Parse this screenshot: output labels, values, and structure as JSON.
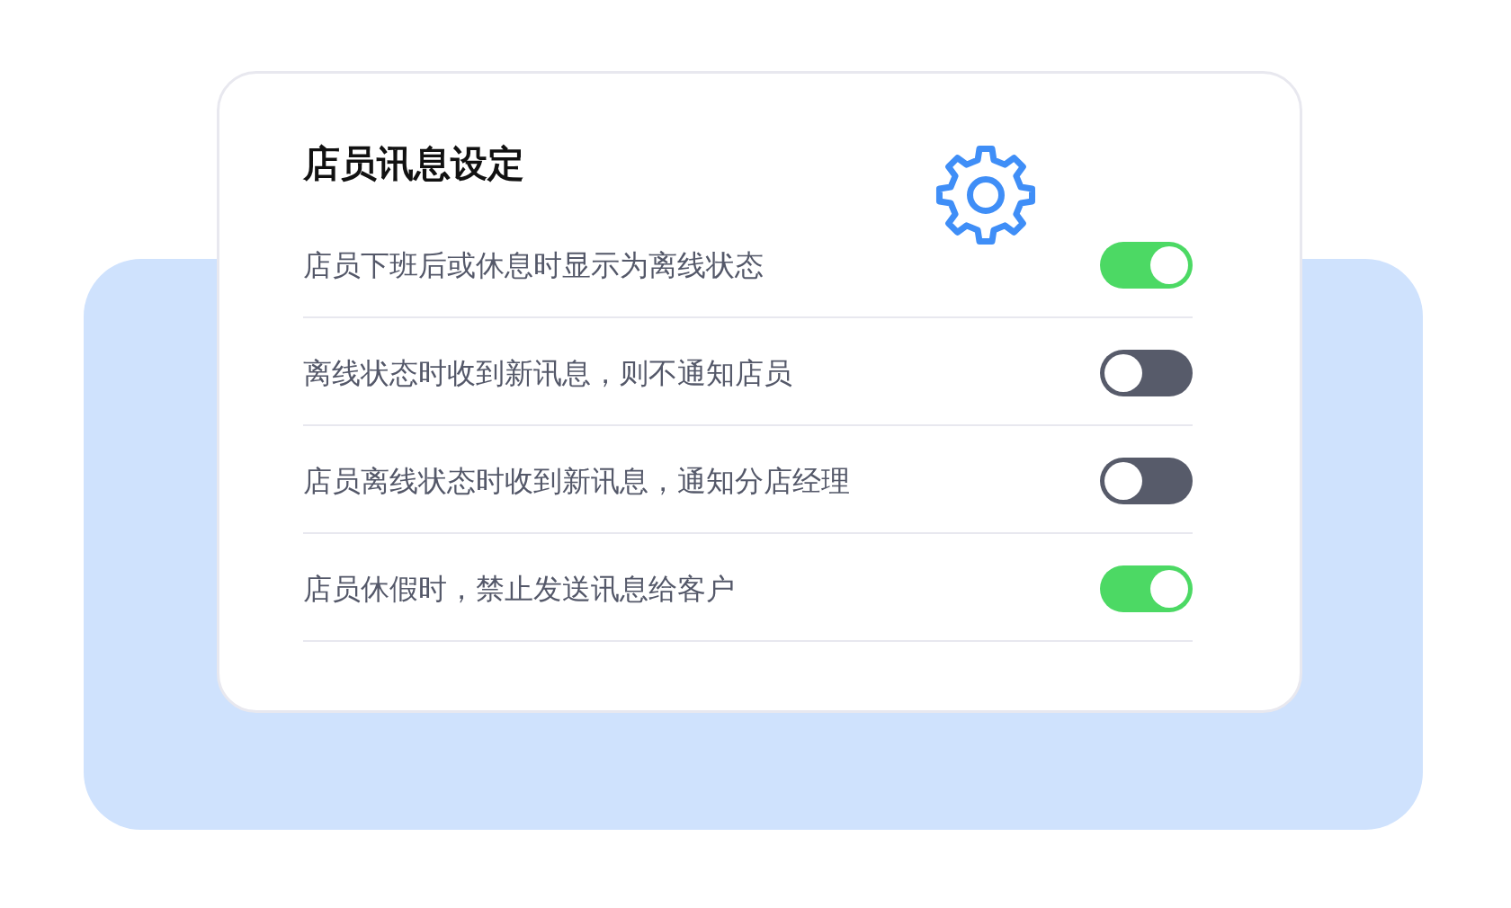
{
  "panel": {
    "title": "店员讯息设定",
    "settings": [
      {
        "label": "店员下班后或休息时显示为离线状态",
        "on": true
      },
      {
        "label": "离线状态时收到新讯息，则不通知店员",
        "on": false
      },
      {
        "label": "店员离线状态时收到新讯息，通知分店经理",
        "on": false
      },
      {
        "label": "店员休假时，禁止发送讯息给客户",
        "on": true
      }
    ]
  }
}
